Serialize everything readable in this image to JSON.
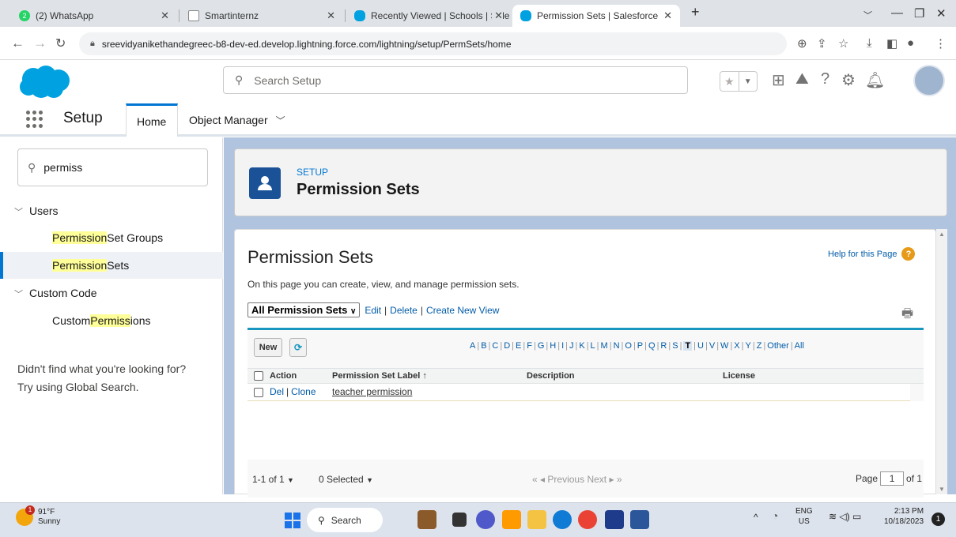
{
  "browser": {
    "tabs": [
      {
        "label": "(2) WhatsApp",
        "color": "#25d366",
        "badge": "2"
      },
      {
        "label": "Smartinternz",
        "color": "#777777",
        "badge": ""
      },
      {
        "label": "Recently Viewed | Schools | Sale",
        "color": "#00a1e0",
        "badge": ""
      },
      {
        "label": "Permission Sets | Salesforce",
        "color": "#00a1e0",
        "badge": ""
      }
    ],
    "new_tab": "+",
    "url": "sreevidyanikethandegreec-b8-dev-ed.develop.lightning.force.com/lightning/setup/PermSets/home"
  },
  "header": {
    "search_placeholder": "Search Setup"
  },
  "nav": {
    "app_name": "Setup",
    "tabs": [
      "Home",
      "Object Manager"
    ]
  },
  "sidebar": {
    "quick_find": "permiss",
    "groups": [
      {
        "label": "Users",
        "items": [
          {
            "match": "Permission",
            "rest": " Set Groups"
          },
          {
            "match": "Permission",
            "rest": " Sets"
          }
        ]
      },
      {
        "label": "Custom Code",
        "items": [
          {
            "prefix": "Custom ",
            "match": "Permiss",
            "rest": "ions"
          }
        ]
      }
    ],
    "help_line1": "Didn't find what you're looking for?",
    "help_line2": "Try using Global Search."
  },
  "page_header": {
    "eyebrow": "SETUP",
    "title": "Permission Sets"
  },
  "content": {
    "title": "Permission Sets",
    "help_link": "Help for this Page",
    "description": "On this page you can create, view, and manage permission sets.",
    "view_select": "All Permission Sets",
    "view_links": [
      "Edit",
      "Delete",
      "Create New View"
    ],
    "new_button": "New",
    "alphabet": [
      "A",
      "B",
      "C",
      "D",
      "E",
      "F",
      "G",
      "H",
      "I",
      "J",
      "K",
      "L",
      "M",
      "N",
      "O",
      "P",
      "Q",
      "R",
      "S",
      "T",
      "U",
      "V",
      "W",
      "X",
      "Y",
      "Z",
      "Other",
      "All"
    ],
    "alphabet_selected": "T",
    "columns": [
      "Action",
      "Permission Set Label ↑",
      "Description",
      "License"
    ],
    "rows": [
      {
        "actions": [
          "Del",
          "Clone"
        ],
        "label": "teacher permission",
        "description": "",
        "license": ""
      }
    ],
    "footer": {
      "range": "1-1 of 1",
      "selected": "0 Selected",
      "prev": "Previous",
      "next": "Next",
      "page_label": "Page",
      "page": "1",
      "of": "of 1"
    }
  },
  "taskbar": {
    "weather_temp": "91°F",
    "weather_desc": "Sunny",
    "weather_badge": "1",
    "search": "Search",
    "lang1": "ENG",
    "lang2": "US",
    "time": "2:13 PM",
    "date": "10/18/2023",
    "notif": "1"
  }
}
